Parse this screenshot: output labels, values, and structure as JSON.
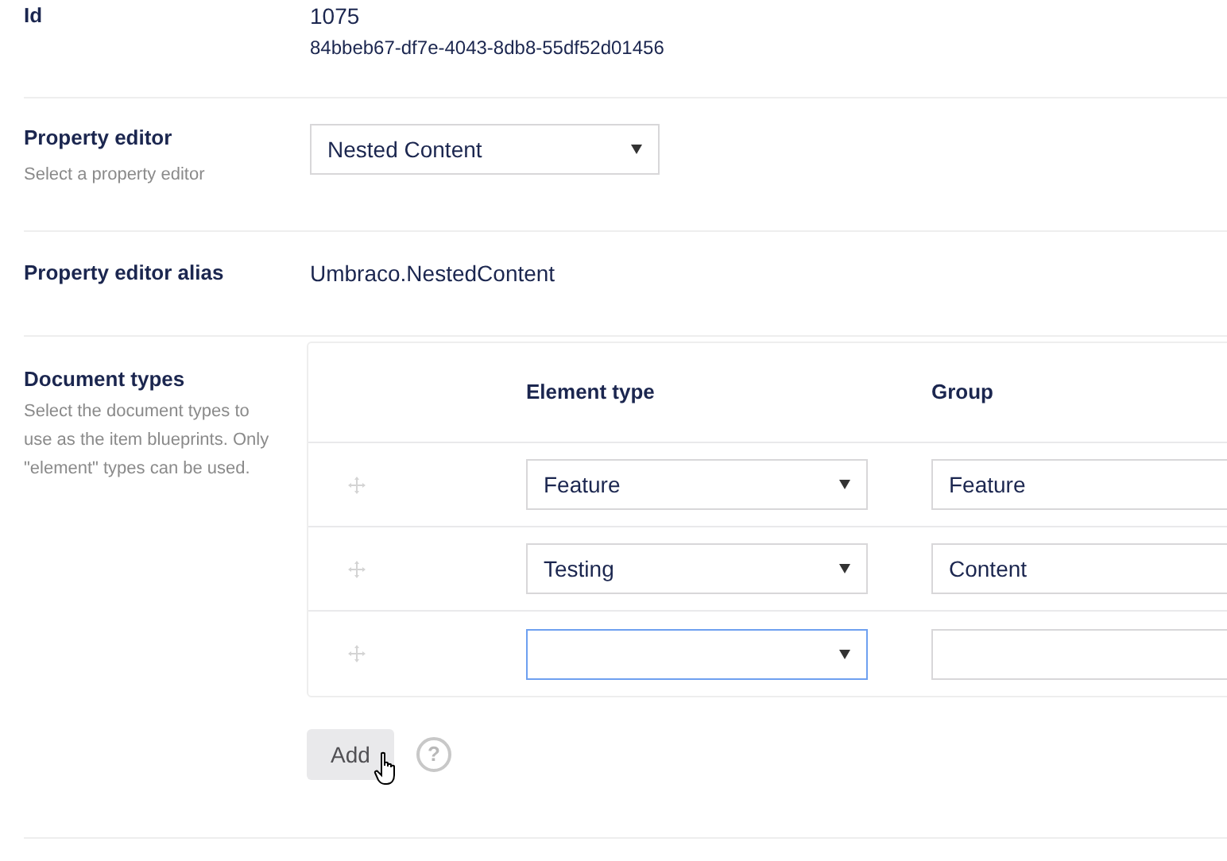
{
  "id_field": {
    "label": "Id",
    "value": "1075",
    "key": "84bbeb67-df7e-4043-8db8-55df52d01456"
  },
  "property_editor": {
    "label": "Property editor",
    "description": "Select a property editor",
    "value": "Nested Content"
  },
  "property_editor_alias": {
    "label": "Property editor alias",
    "value": "Umbraco.NestedContent"
  },
  "document_types": {
    "label": "Document types",
    "description": "Select the document types to use as the item blueprints. Only \"element\" types can be used.",
    "columns": [
      "Element type",
      "Group"
    ],
    "rows": [
      {
        "element_type": "Feature",
        "group": "Feature",
        "focused": false
      },
      {
        "element_type": "Testing",
        "group": "Content",
        "focused": false
      },
      {
        "element_type": "",
        "group": "",
        "focused": true
      }
    ],
    "add_button": "Add",
    "help_icon_text": "?"
  }
}
